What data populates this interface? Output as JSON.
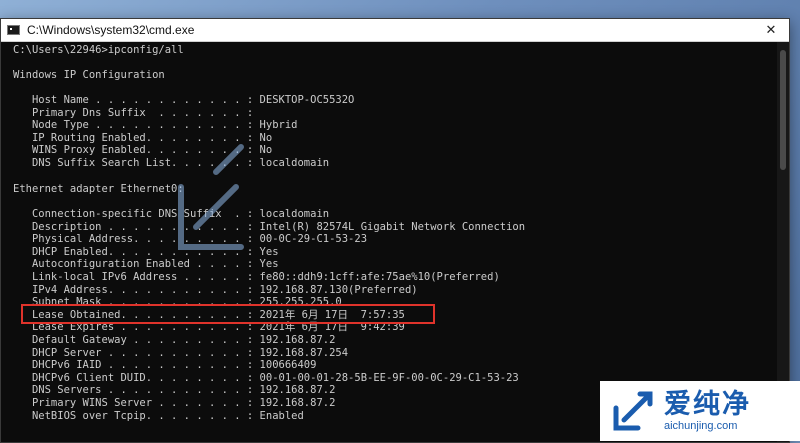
{
  "window": {
    "title": "C:\\Windows\\system32\\cmd.exe",
    "close_symbol": "✕"
  },
  "console": {
    "prompt_line": "C:\\Users\\22946>ipconfig/all",
    "header": "Windows IP Configuration",
    "ip_config": [
      {
        "label": "   Host Name . . . . . . . . . . . . :",
        "value": "DESKTOP-OC5532O"
      },
      {
        "label": "   Primary Dns Suffix  . . . . . . . :",
        "value": ""
      },
      {
        "label": "   Node Type . . . . . . . . . . . . :",
        "value": "Hybrid"
      },
      {
        "label": "   IP Routing Enabled. . . . . . . . :",
        "value": "No"
      },
      {
        "label": "   WINS Proxy Enabled. . . . . . . . :",
        "value": "No"
      },
      {
        "label": "   DNS Suffix Search List. . . . . . :",
        "value": "localdomain"
      }
    ],
    "adapter_header": "Ethernet adapter Ethernet0:",
    "adapter": [
      {
        "label": "   Connection-specific DNS Suffix  . :",
        "value": "localdomain"
      },
      {
        "label": "   Description . . . . . . . . . . . :",
        "value": "Intel(R) 82574L Gigabit Network Connection"
      },
      {
        "label": "   Physical Address. . . . . . . . . :",
        "value": "00-0C-29-C1-53-23"
      },
      {
        "label": "   DHCP Enabled. . . . . . . . . . . :",
        "value": "Yes"
      },
      {
        "label": "   Autoconfiguration Enabled . . . . :",
        "value": "Yes"
      },
      {
        "label": "   Link-local IPv6 Address . . . . . :",
        "value": "fe80::ddh9:1cff:afe:75ae%10(Preferred)"
      },
      {
        "label": "   IPv4 Address. . . . . . . . . . . :",
        "value": "192.168.87.130(Preferred)"
      },
      {
        "label": "   Subnet Mask . . . . . . . . . . . :",
        "value": "255.255.255.0"
      },
      {
        "label": "   Lease Obtained. . . . . . . . . . :",
        "value": "2021年 6月 17日  7:57:35"
      },
      {
        "label": "   Lease Expires . . . . . . . . . . :",
        "value": "2021年 6月 17日  9:42:39"
      },
      {
        "label": "   Default Gateway . . . . . . . . . :",
        "value": "192.168.87.2"
      },
      {
        "label": "   DHCP Server . . . . . . . . . . . :",
        "value": "192.168.87.254"
      },
      {
        "label": "   DHCPv6 IAID . . . . . . . . . . . :",
        "value": "100666409"
      },
      {
        "label": "   DHCPv6 Client DUID. . . . . . . . :",
        "value": "00-01-00-01-28-5B-EE-9F-00-0C-29-C1-53-23"
      },
      {
        "label": "   DNS Servers . . . . . . . . . . . :",
        "value": "192.168.87.2"
      },
      {
        "label": "   Primary WINS Server . . . . . . . :",
        "value": "192.168.87.2"
      },
      {
        "label": "   NetBIOS over Tcpip. . . . . . . . :",
        "value": "Enabled"
      }
    ]
  },
  "watermark": {
    "cn": "爱纯净",
    "url": "aichunjing.com"
  },
  "colors": {
    "console_bg": "#0c0c0c",
    "console_text": "#cccccc",
    "highlight": "#e0332b",
    "brand": "#1a5cae"
  }
}
